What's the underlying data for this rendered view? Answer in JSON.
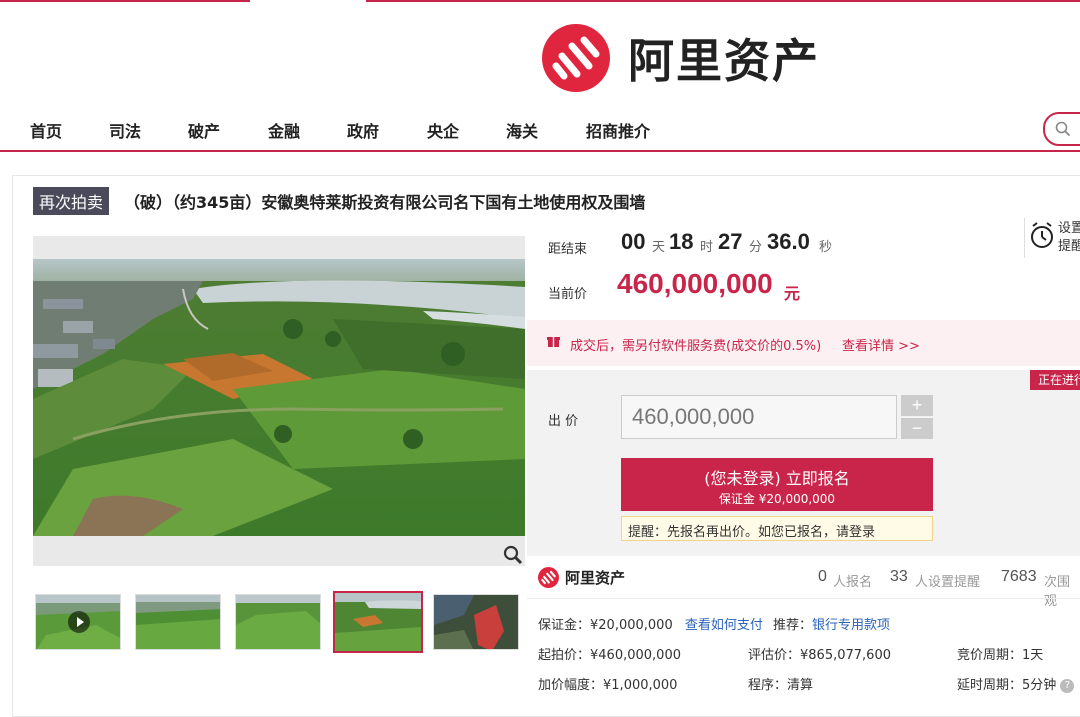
{
  "brand": {
    "name": "阿里资产",
    "color": "#c9254a",
    "logo_icon": "ali-assets-logo"
  },
  "nav": {
    "items": [
      {
        "label": "首页"
      },
      {
        "label": "司法"
      },
      {
        "label": "破产"
      },
      {
        "label": "金融"
      },
      {
        "label": "政府"
      },
      {
        "label": "央企"
      },
      {
        "label": "海关"
      },
      {
        "label": "招商推介"
      }
    ],
    "search_icon": "search-icon"
  },
  "auction": {
    "badge": "再次拍卖",
    "title": "（破）（约345亩）安徽奥特莱斯投资有限公司名下国有土地使用权及围墙",
    "countdown": {
      "label": "距结束",
      "days": "00",
      "days_unit": "天",
      "hours": "18",
      "hours_unit": "时",
      "minutes": "27",
      "minutes_unit": "分",
      "seconds": "36.0",
      "seconds_unit": "秒"
    },
    "current_price": {
      "label": "当前价",
      "value": "460,000,000",
      "unit": "元"
    },
    "reminder": {
      "label": "设置\n提醒",
      "icon": "alarm-clock-icon"
    },
    "fee_notice": {
      "text": "成交后，需另付软件服务费(成交价的0.5%)",
      "link": "查看详情 >>",
      "icon": "gift-icon"
    },
    "status": "正在进行",
    "bid": {
      "label": "出 价",
      "value": "460,000,000",
      "plus": "+",
      "minus": "−"
    },
    "signup": {
      "main": "(您未登录) 立即报名",
      "sub": "保证金 ¥20,000,000"
    },
    "tip": {
      "prefix": "提醒：先报名再出价。如您已报名，请",
      "link": "登录"
    }
  },
  "stats": {
    "logo_text": "阿里资产",
    "signups": "0",
    "signups_label": "人报名",
    "reminders": "33",
    "reminders_label": "人设置提醒",
    "views": "7683",
    "views_label": "次围观"
  },
  "details": {
    "deposit_label": "保证金：",
    "deposit_value": "¥20,000,000",
    "pay_link": "查看如何支付",
    "recommend_label": "推荐：",
    "recommend_link": "银行专用款项",
    "start_label": "起拍价：",
    "start_value": "¥460,000,000",
    "eval_label": "评估价：",
    "eval_value": "¥865,077,600",
    "cycle_label": "竞价周期：",
    "cycle_value": "1天",
    "increment_label": "加价幅度：",
    "increment_value": "¥1,000,000",
    "procedure_label": "程序：",
    "procedure_value": "清算",
    "delay_label": "延时周期：",
    "delay_value": "5分钟"
  },
  "gallery": {
    "zoom_icon": "zoom-icon",
    "thumbnails": [
      {
        "kind": "video"
      },
      {
        "kind": "image"
      },
      {
        "kind": "image"
      },
      {
        "kind": "image",
        "active": true
      },
      {
        "kind": "map"
      }
    ]
  }
}
